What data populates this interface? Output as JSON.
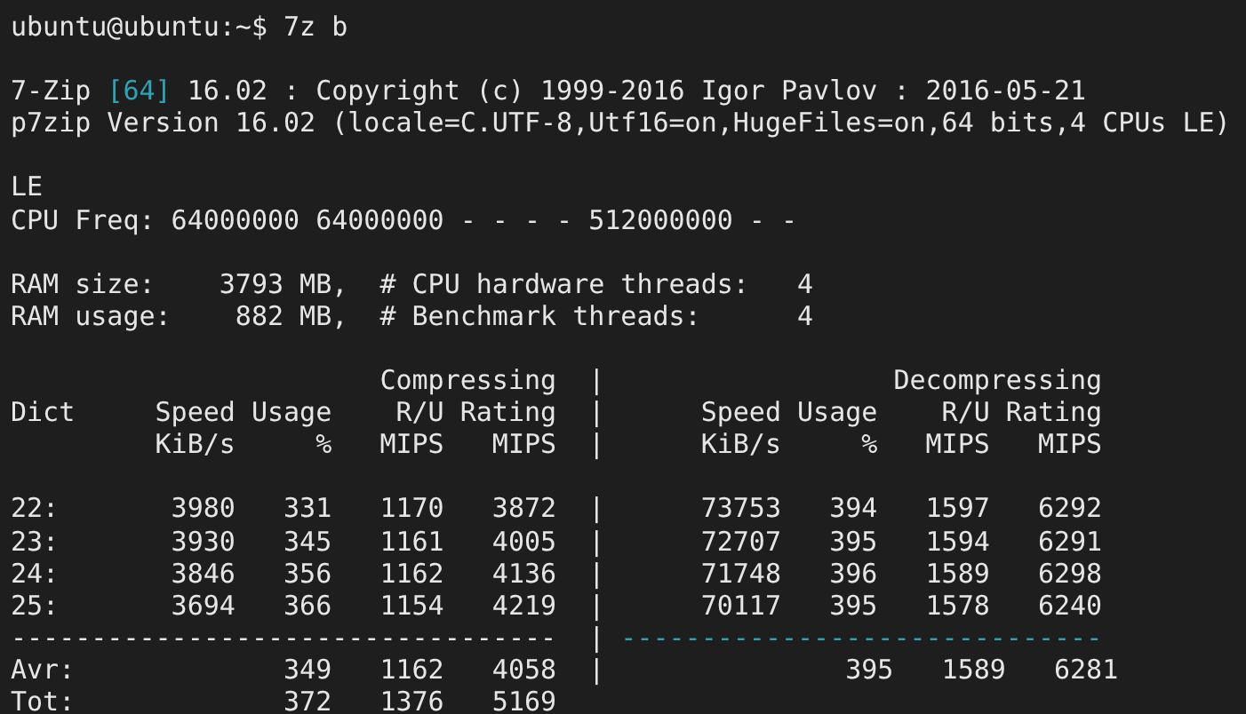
{
  "terminal": {
    "blocks": [
      {
        "lines": [
          [
            {
              "kind": "plain",
              "text": "ubuntu@ubuntu:~$ 7z b"
            }
          ]
        ]
      },
      {
        "lines": [
          [
            {
              "kind": "plain",
              "text": "7-Zip "
            },
            {
              "kind": "accent",
              "text": "[64]"
            },
            {
              "kind": "plain",
              "text": " 16.02 : Copyright (c) 1999-2016 Igor Pavlov : 2016-05-21"
            }
          ],
          [
            {
              "kind": "plain",
              "text": "p7zip Version 16.02 (locale=C.UTF-8,Utf16=on,HugeFiles=on,64 bits,4 CPUs LE)"
            }
          ]
        ]
      },
      {
        "lines": [
          [
            {
              "kind": "plain",
              "text": "LE"
            }
          ],
          [
            {
              "kind": "plain",
              "text": "CPU Freq: 64000000 64000000 - - - - 512000000 - -"
            }
          ]
        ]
      },
      {
        "lines": [
          [
            {
              "kind": "plain",
              "text": "RAM size:    3793 MB,  # CPU hardware threads:   4"
            }
          ],
          [
            {
              "kind": "plain",
              "text": "RAM usage:    882 MB,  # Benchmark threads:      4"
            }
          ]
        ]
      },
      {
        "lines": [
          [
            {
              "kind": "plain",
              "text": "                       Compressing  |                  Decompressing"
            }
          ],
          [
            {
              "kind": "plain",
              "text": "Dict     Speed Usage    R/U Rating  |      Speed Usage    R/U Rating"
            }
          ],
          [
            {
              "kind": "plain",
              "text": "         KiB/s     %   MIPS   MIPS  |      KiB/s     %   MIPS   MIPS"
            }
          ]
        ]
      },
      {
        "lines": [
          [
            {
              "kind": "plain",
              "text": "22:       3980   331   1170   3872  |      73753   394   1597   6292"
            }
          ],
          [
            {
              "kind": "plain",
              "text": "23:       3930   345   1161   4005  |      72707   395   1594   6291"
            }
          ],
          [
            {
              "kind": "plain",
              "text": "24:       3846   356   1162   4136  |      71748   396   1589   6298"
            }
          ],
          [
            {
              "kind": "plain",
              "text": "25:       3694   366   1154   4219  |      70117   395   1578   6240"
            }
          ],
          [
            {
              "kind": "plain",
              "text": "----------------------------------  | "
            },
            {
              "kind": "accent",
              "text": "------------------------------"
            }
          ],
          [
            {
              "kind": "plain",
              "text": "Avr:             349   1162   4058  |               395   1589   6281"
            }
          ],
          [
            {
              "kind": "plain",
              "text": "Tot:             372   1376   5169"
            }
          ]
        ]
      }
    ]
  }
}
